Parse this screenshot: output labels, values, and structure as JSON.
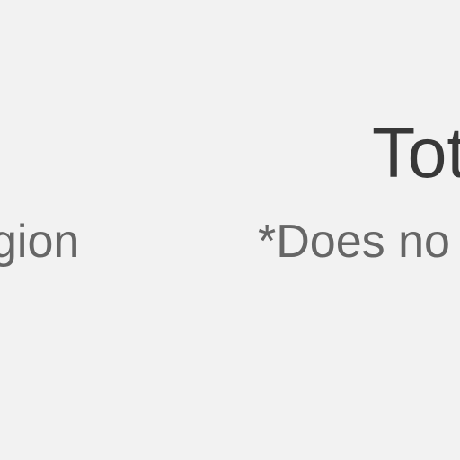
{
  "content": {
    "heading_fragment": "Tot",
    "region_fragment": "gion",
    "note_fragment": "*Does no"
  },
  "colors": {
    "background": "#f2f2f2",
    "heading_text": "#383838",
    "secondary_text": "#666666"
  }
}
